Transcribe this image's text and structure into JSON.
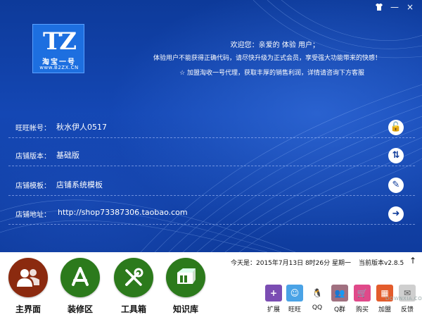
{
  "window": {
    "skin_icon": "tshirt-icon",
    "minimize_label": "—",
    "close_label": "×"
  },
  "logo": {
    "mark": "TZ",
    "name": "淘宝一号",
    "url": "www.B2ZX.CN"
  },
  "header": {
    "welcome": "欢迎您：亲爱的 体验 用户；",
    "notice": "体验用户不能获得正确代码，请尽快升级为正式会员，享受强大功能带来的快感！",
    "agent": "☆ 加盟淘收一号代理，获取丰厚的销售利润，详情请咨询下方客服"
  },
  "info_rows": [
    {
      "label": "旺旺帐号：",
      "value": "秋水伊人0517",
      "action_icon": "lock-icon",
      "action_glyph": "🔓"
    },
    {
      "label": "店铺版本：",
      "value": "基础版",
      "action_icon": "swap-icon",
      "action_glyph": "⇅"
    },
    {
      "label": "店铺模板：",
      "value": "店铺系统模板",
      "action_icon": "edit-icon",
      "action_glyph": "✎"
    },
    {
      "label": "店铺地址：",
      "value": "http://shop73387306.taobao.com",
      "action_icon": "arrow-right-icon",
      "action_glyph": "➜"
    }
  ],
  "nav": [
    {
      "label": "主界面",
      "icon": "users-icon",
      "color": "#8b2a0f"
    },
    {
      "label": "装修区",
      "icon": "app-store-icon",
      "color": "#2c7a1c"
    },
    {
      "label": "工具箱",
      "icon": "tools-icon",
      "color": "#2c7a1c"
    },
    {
      "label": "知识库",
      "icon": "books-icon",
      "color": "#2c7a1c"
    }
  ],
  "status": {
    "datetime": "今天是：2015年7月13日  8时26分  星期一",
    "version": "当前版本v2.8.5",
    "up_glyph": "↑"
  },
  "tools": [
    {
      "label": "扩展",
      "icon": "extend-icon",
      "color": "#7b4db3",
      "glyph": "+"
    },
    {
      "label": "旺旺",
      "icon": "wangwang-icon",
      "color": "#f3a21a",
      "glyph": "☺"
    },
    {
      "label": "QQ",
      "icon": "qq-icon",
      "color": "#ffffff",
      "glyph": "🐧"
    },
    {
      "label": "Q群",
      "icon": "qq-group-icon",
      "color": "#e0a0a0",
      "glyph": "👥"
    },
    {
      "label": "购买",
      "icon": "cart-icon",
      "color": "#e0498a",
      "glyph": "🛒"
    },
    {
      "label": "加盟",
      "icon": "join-icon",
      "color": "#e35c2c",
      "glyph": "▦"
    },
    {
      "label": "反馈",
      "icon": "feedback-icon",
      "color": "#cfcfcf",
      "glyph": "✉"
    }
  ],
  "watermark": "DOWNXIA.COM"
}
